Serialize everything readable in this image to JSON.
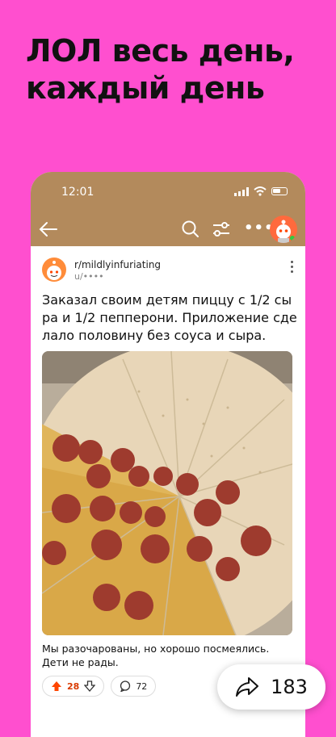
{
  "headline": "ЛОЛ весь день, каждый день",
  "colors": {
    "background": "#ff4fcf",
    "appbar": "#b38a5c",
    "upvote": "#ff4500"
  },
  "status": {
    "time": "12:01"
  },
  "appbar": {
    "back_icon": "arrow-left-icon",
    "search_icon": "search-icon",
    "filter_icon": "sliders-icon",
    "more_label": "•••",
    "avatar_icon": "user-avatar-icon"
  },
  "post": {
    "subreddit": "r/mildlyinfuriating",
    "username": "u/••••",
    "title": "Заказал своим детям пиццу с 1/2 сыра и 1/2 пепперони. Приложение сделало половину без соуса и сыра.",
    "caption": "Мы разочарованы, но хорошо посмеялись. Дети не рады.",
    "upvotes": "28",
    "comments": "72"
  },
  "share": {
    "count": "183"
  }
}
